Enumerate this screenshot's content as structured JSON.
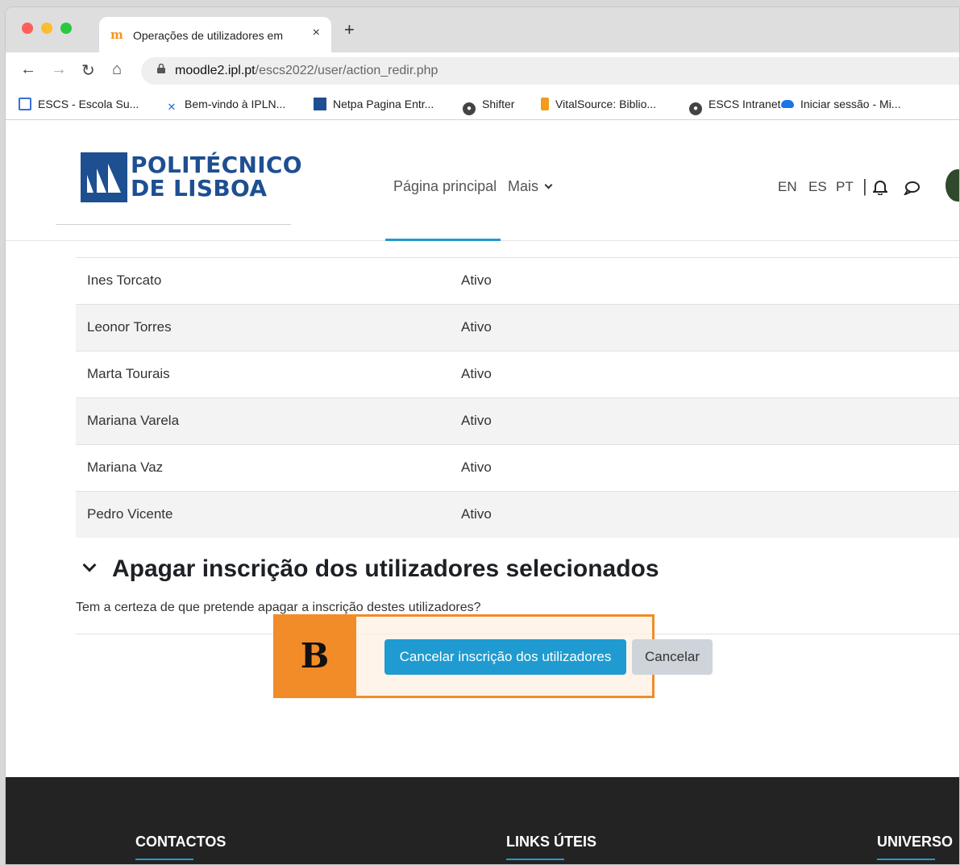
{
  "browser": {
    "tab_title": "Operações de utilizadores em",
    "tab_close": "×",
    "new_tab": "+",
    "url_host": "moodle2.ipl.pt",
    "url_path": "/escs2022/user/action_redir.php",
    "bookmarks": [
      "ESCS - Escola Su...",
      "Bem-vindo à IPLN...",
      "Netpa Pagina Entr...",
      "Shifter",
      "VitalSource: Biblio...",
      "ESCS Intranet",
      "Iniciar sessão - Mi..."
    ]
  },
  "header": {
    "logo_line1": "POLITÉCNICO",
    "logo_line2": "DE LISBOA",
    "nav_home": "Página principal",
    "nav_more": "Mais",
    "lang_en": "EN",
    "lang_es": "ES",
    "lang_pt": "PT"
  },
  "users": [
    {
      "name": "Ines Torcato",
      "status": "Ativo"
    },
    {
      "name": "Leonor Torres",
      "status": "Ativo"
    },
    {
      "name": "Marta Tourais",
      "status": "Ativo"
    },
    {
      "name": "Mariana Varela",
      "status": "Ativo"
    },
    {
      "name": "Mariana Vaz",
      "status": "Ativo"
    },
    {
      "name": "Pedro Vicente",
      "status": "Ativo"
    }
  ],
  "section": {
    "title": "Apagar inscrição dos utilizadores selecionados",
    "confirm": "Tem a certeza de que pretende apagar a inscrição destes utilizadores?",
    "submit": "Cancelar inscrição dos utilizadores",
    "cancel": "Cancelar"
  },
  "overlay": {
    "label": "B",
    "color": "#f28c28"
  },
  "footer": {
    "col1": "CONTACTOS",
    "col2": "LINKS ÚTEIS",
    "col3": "UNIVERSO"
  },
  "colors": {
    "brand": "#1d4f91",
    "accent": "#1f9bd1"
  }
}
